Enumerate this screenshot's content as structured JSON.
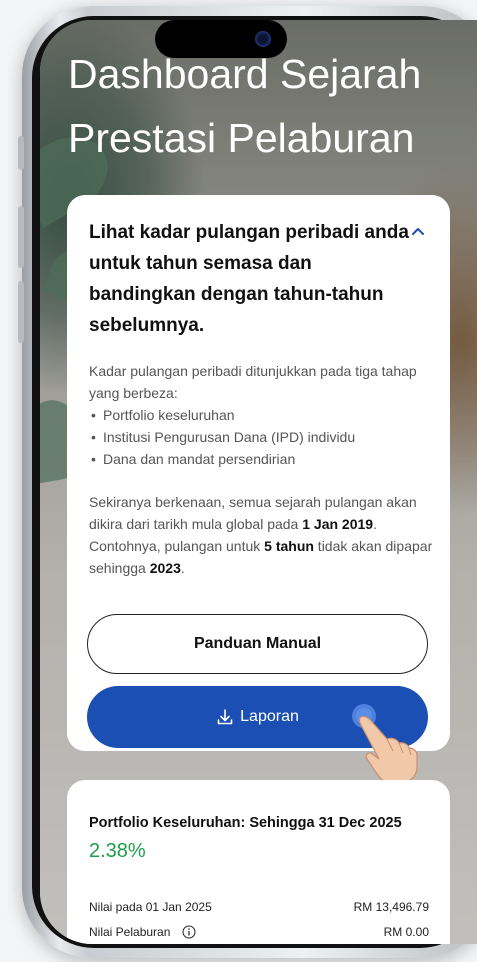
{
  "header": {
    "title_line1": "Dashboard Sejarah",
    "title_line2": "Prestasi Pelaburan"
  },
  "info_card": {
    "heading": "Lihat kadar pulangan peribadi anda untuk tahun semasa dan bandingkan dengan tahun-tahun sebelumnya.",
    "collapse_icon": "chevron-up-icon",
    "intro": "Kadar pulangan peribadi ditunjukkan pada tiga tahap yang berbeza:",
    "levels": [
      "Portfolio keseluruhan",
      "Institusi Pengurusan Dana (IPD) individu",
      "Dana dan mandat persendirian"
    ],
    "note_part1": "Sekiranya berkenaan, semua sejarah pulangan akan dikira dari tarikh mula global pada ",
    "note_date": "1 Jan 2019",
    "note_part2": ". Contohnya, pulangan untuk ",
    "note_period": "5 tahun",
    "note_part3": " tidak akan dipapar sehingga ",
    "note_year": "2023",
    "note_end": ".",
    "manual_button": "Panduan Manual",
    "report_button": "Laporan",
    "report_icon": "download-icon"
  },
  "portfolio_card": {
    "title": "Portfolio Keseluruhan: Sehingga 31 Dec 2025",
    "return_pct": "2.38%",
    "rows": [
      {
        "label": "Nilai pada 01 Jan 2025",
        "value": "RM 13,496.79"
      },
      {
        "label": "Nilai Pelaburan",
        "value": "RM 0.00"
      }
    ]
  },
  "colors": {
    "primary": "#1b4fb3",
    "positive": "#1e9e4a"
  }
}
